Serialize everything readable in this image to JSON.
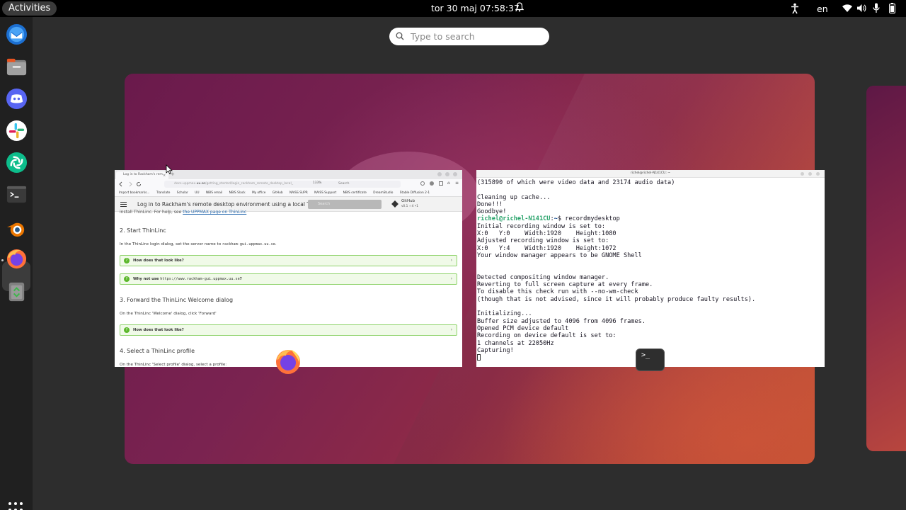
{
  "topbar": {
    "activities": "Activities",
    "clock": "tor 30 maj  07:58:37",
    "language": "en"
  },
  "dock": {
    "apps": [
      "thunderbird-icon",
      "files-icon",
      "discord-icon",
      "slack-icon",
      "element-icon",
      "terminal-icon",
      "blender-icon",
      "firefox-icon",
      "trash-icon"
    ],
    "active": "firefox"
  },
  "search": {
    "placeholder": "Type to search"
  },
  "browser": {
    "tab_label": "Log in to Rackham's rem",
    "url_prefix": "docs.uppmax.",
    "url_domain": "uu.se",
    "url_path": "/getting_started/login_rackham_remote_desktop_local_",
    "zoom": "133%",
    "search_placeholder": "Search",
    "bookmarks": [
      "Import bookmarks...",
      "Translate",
      "Scholar",
      "UU",
      "NBIS email",
      "NBIS Slack",
      "My office",
      "GitHub",
      "NAISS SUPR",
      "NAISS Support",
      "NBIS certificate",
      "DreamStudio",
      "Stable Diffusion 2-1"
    ],
    "page_title": "Log in to Rackham's remote desktop environment using a local Thin...",
    "doc_search": "Search",
    "github_label": "GitHub",
    "github_meta": "v0.1  ☆4  ⑂1",
    "content": {
      "cut_text": "install ThinLinc. For help, see ",
      "cut_link": "the UPPMAX page on ThinLinc",
      "h2": "2. Start ThinLinc",
      "p2_text": "In the ThinLinc login dialog, set the server name to ",
      "p2_code": "rackham-gui.uppmax.uu.se",
      "box1": "How does that look like?",
      "box2_text": "Why not use ",
      "box2_code": "https://www.rackham-gui.uppmax.uu.se",
      "box2_end": "?",
      "h3": "3. Forward the ThinLinc Welcome dialog",
      "p3": "On the ThinLinc 'Welcome' dialog, click 'Forward'",
      "box3": "How does that look like?",
      "h4": "4. Select a ThinLinc profile",
      "p4": "On the ThinLinc 'Select profile' dialog, select a profile:"
    }
  },
  "terminal": {
    "title": "richel@richel-N141CU: ~",
    "lines": [
      "(315890 of which were video data and 23174 audio data)",
      "",
      "Cleaning up cache...",
      "Done!!!",
      "Goodbye!"
    ],
    "prompt_user": "richel@richel-N141CU",
    "prompt_path": "~",
    "prompt_command": "$ recordmydesktop",
    "output": [
      "Initial recording window is set to:",
      "X:0   Y:0    Width:1920    Height:1080",
      "Adjusted recording window is set to:",
      "X:0   Y:4    Width:1920    Height:1072",
      "Your window manager appears to be GNOME Shell",
      "",
      "",
      "Detected compositing window manager.",
      "Reverting to full screen capture at every frame.",
      "To disable this check run with --no-wm-check",
      "(though that is not advised, since it will probably produce faulty results).",
      "",
      "Initializing...",
      "Buffer size adjusted to 4096 from 4096 frames.",
      "Opened PCM device default",
      "Recording on device default is set to:",
      "1 channels at 22050Hz",
      "Capturing!"
    ]
  }
}
